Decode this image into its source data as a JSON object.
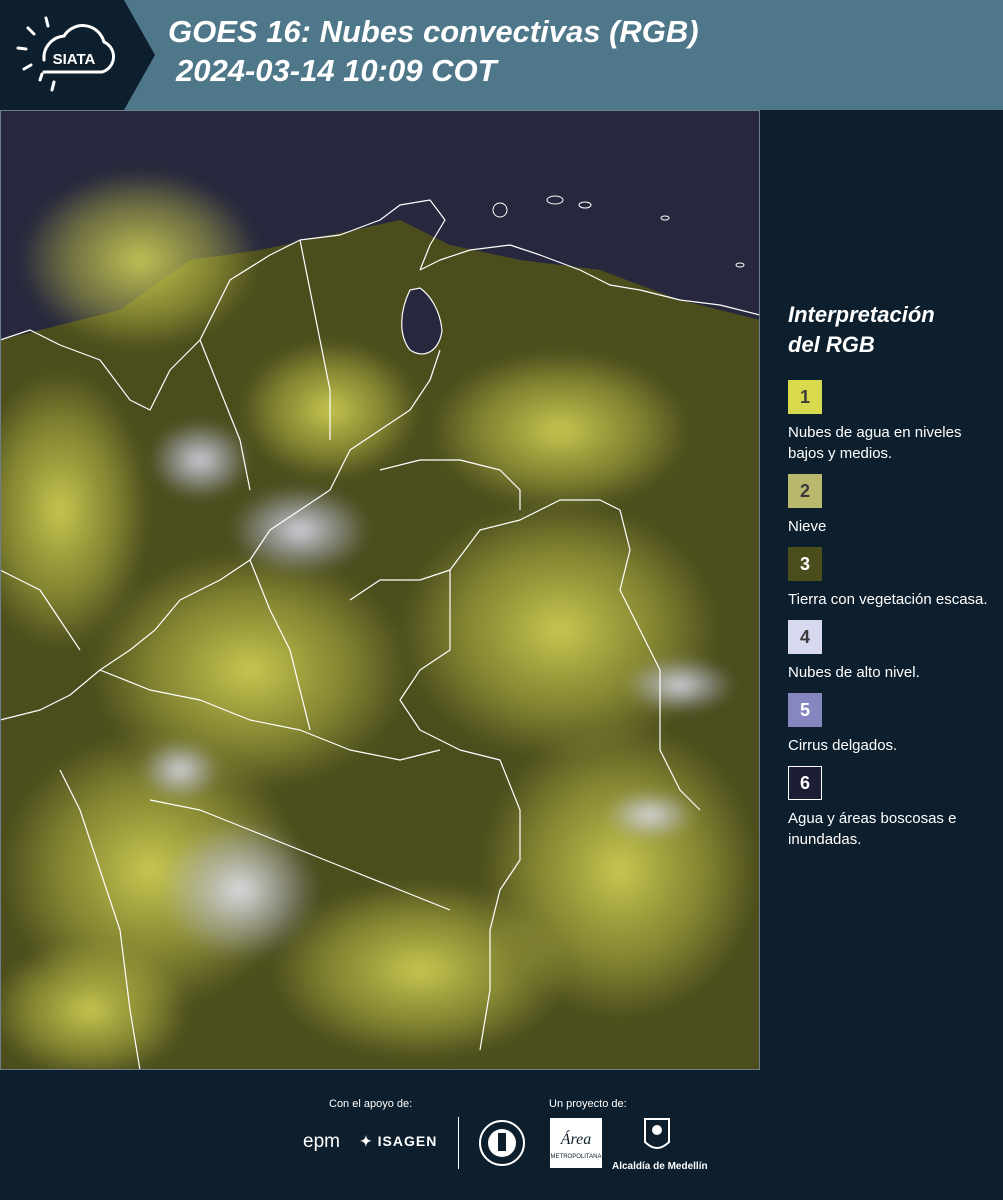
{
  "header": {
    "logo_text": "SIATA",
    "title_line1": "GOES 16: Nubes convectivas (RGB)",
    "title_line2": "2024-03-14 10:09 COT"
  },
  "legend": {
    "title": "Interpretación\ndel RGB",
    "items": [
      {
        "number": "1",
        "label": "Nubes de agua en niveles bajos y medios.",
        "color": "#d9d94e"
      },
      {
        "number": "2",
        "label": "Nieve",
        "color": "#b9b86c"
      },
      {
        "number": "3",
        "label": "Tierra con vegetación escasa.",
        "color": "#4b4d1d"
      },
      {
        "number": "4",
        "label": "Nubes de alto nivel.",
        "color": "#d8d8ee"
      },
      {
        "number": "5",
        "label": "Cirrus delgados.",
        "color": "#8686c0"
      },
      {
        "number": "6",
        "label": "Agua y áreas boscosas e inundadas.",
        "color": "#1c1e35"
      }
    ]
  },
  "footer": {
    "support_label": "Con el apoyo de:",
    "project_label": "Un proyecto de:",
    "epm": "epm",
    "isagen": "ISAGEN",
    "area_metropolitana": "Área",
    "area_sub": "METROPOLITANA",
    "alcaldia": "Alcaldía de Medellín"
  },
  "colors": {
    "header_bg": "#4e7789",
    "page_bg": "#0d1f2d",
    "ocean": "#27283d",
    "land": "#4b4d1d",
    "cloud_low": "#d9d94e",
    "cloud_high": "#d8d8ee"
  }
}
